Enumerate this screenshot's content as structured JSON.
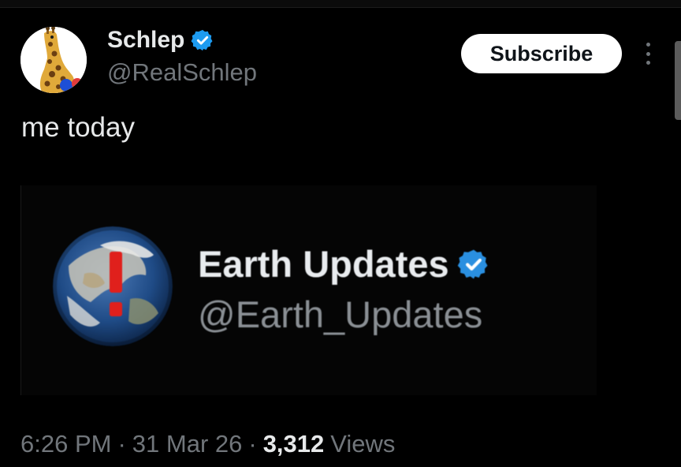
{
  "post": {
    "author_name": "Schlep",
    "author_handle": "@RealSchlep",
    "subscribe_label": "Subscribe",
    "text": "me today",
    "time": "6:26 PM",
    "separator": "·",
    "date": "31 Mar 26",
    "views_count": "3,312",
    "views_label": "Views"
  },
  "media": {
    "account_name": "Earth Updates",
    "account_handle": "@Earth_Updates"
  },
  "icons": {
    "verified": "verified-badge-icon",
    "more": "more-vertical-icon"
  },
  "colors": {
    "background": "#000000",
    "text": "#e7e9ea",
    "secondary_text": "#71767b",
    "verified_blue": "#1d9bf0",
    "button_bg": "#ffffff"
  }
}
